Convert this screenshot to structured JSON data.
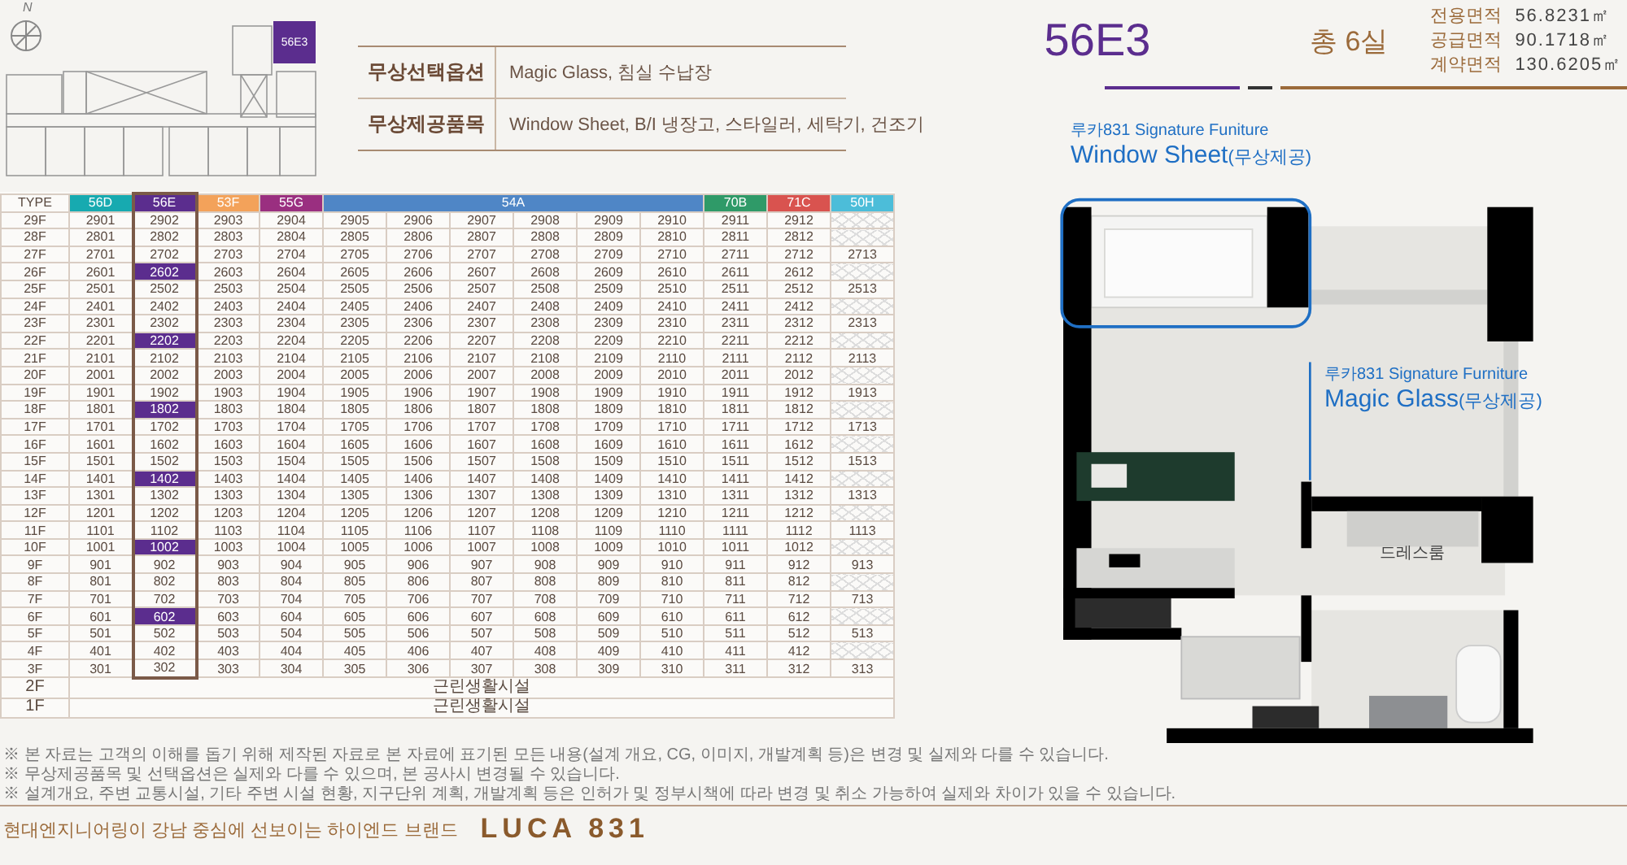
{
  "site_plan": {
    "compass_label": "N",
    "unit_label": "56E3"
  },
  "options": [
    {
      "label": "무상선택옵션",
      "value": "Magic Glass, 침실 수납장"
    },
    {
      "label": "무상제공품목",
      "value": "Window Sheet, B/I 냉장고, 스타일러, 세탁기, 건조기"
    }
  ],
  "unit_table": {
    "corner": "TYPE",
    "types": [
      {
        "label": "56D",
        "color": "#17aab0",
        "wide": false,
        "selected": false
      },
      {
        "label": "56E",
        "color": "#5b2d8e",
        "wide": false,
        "selected": true
      },
      {
        "label": "53F",
        "color": "#f3a25a",
        "wide": false,
        "selected": false
      },
      {
        "label": "55G",
        "color": "#9a2f80",
        "wide": false,
        "selected": false
      },
      {
        "label": "54A",
        "color": "#4f86c6",
        "wide": true,
        "selected": false
      },
      {
        "label": "70B",
        "color": "#2f9a68",
        "wide": false,
        "selected": false
      },
      {
        "label": "71C",
        "color": "#d9534f",
        "wide": false,
        "selected": false
      },
      {
        "label": "50H",
        "color": "#4cbdd9",
        "wide": false,
        "selected": false
      }
    ],
    "rows": [
      {
        "floor": "29F",
        "units": [
          "2901",
          "2902",
          "2903",
          "2904",
          "2905",
          "2906",
          "2907",
          "2908",
          "2909",
          "2910",
          "2911",
          "2912"
        ],
        "highlighted": false
      },
      {
        "floor": "28F",
        "units": [
          "2801",
          "2802",
          "2803",
          "2804",
          "2805",
          "2806",
          "2807",
          "2808",
          "2809",
          "2810",
          "2811",
          "2812"
        ],
        "highlighted": false
      },
      {
        "floor": "27F",
        "units": [
          "2701",
          "2702",
          "2703",
          "2704",
          "2705",
          "2706",
          "2707",
          "2708",
          "2709",
          "2710",
          "2711",
          "2712",
          "2713"
        ],
        "highlighted": false
      },
      {
        "floor": "26F",
        "units": [
          "2601",
          "2602",
          "2603",
          "2604",
          "2605",
          "2606",
          "2607",
          "2608",
          "2609",
          "2610",
          "2611",
          "2612"
        ],
        "highlighted": true
      },
      {
        "floor": "25F",
        "units": [
          "2501",
          "2502",
          "2503",
          "2504",
          "2505",
          "2506",
          "2507",
          "2508",
          "2509",
          "2510",
          "2511",
          "2512",
          "2513"
        ],
        "highlighted": false
      },
      {
        "floor": "24F",
        "units": [
          "2401",
          "2402",
          "2403",
          "2404",
          "2405",
          "2406",
          "2407",
          "2408",
          "2409",
          "2410",
          "2411",
          "2412"
        ],
        "highlighted": false
      },
      {
        "floor": "23F",
        "units": [
          "2301",
          "2302",
          "2303",
          "2304",
          "2305",
          "2306",
          "2307",
          "2308",
          "2309",
          "2310",
          "2311",
          "2312",
          "2313"
        ],
        "highlighted": false
      },
      {
        "floor": "22F",
        "units": [
          "2201",
          "2202",
          "2203",
          "2204",
          "2205",
          "2206",
          "2207",
          "2208",
          "2209",
          "2210",
          "2211",
          "2212"
        ],
        "highlighted": true
      },
      {
        "floor": "21F",
        "units": [
          "2101",
          "2102",
          "2103",
          "2104",
          "2105",
          "2106",
          "2107",
          "2108",
          "2109",
          "2110",
          "2111",
          "2112",
          "2113"
        ],
        "highlighted": false
      },
      {
        "floor": "20F",
        "units": [
          "2001",
          "2002",
          "2003",
          "2004",
          "2005",
          "2006",
          "2007",
          "2008",
          "2009",
          "2010",
          "2011",
          "2012"
        ],
        "highlighted": false
      },
      {
        "floor": "19F",
        "units": [
          "1901",
          "1902",
          "1903",
          "1904",
          "1905",
          "1906",
          "1907",
          "1908",
          "1909",
          "1910",
          "1911",
          "1912",
          "1913"
        ],
        "highlighted": false
      },
      {
        "floor": "18F",
        "units": [
          "1801",
          "1802",
          "1803",
          "1804",
          "1805",
          "1806",
          "1807",
          "1808",
          "1809",
          "1810",
          "1811",
          "1812"
        ],
        "highlighted": true
      },
      {
        "floor": "17F",
        "units": [
          "1701",
          "1702",
          "1703",
          "1704",
          "1705",
          "1706",
          "1707",
          "1708",
          "1709",
          "1710",
          "1711",
          "1712",
          "1713"
        ],
        "highlighted": false
      },
      {
        "floor": "16F",
        "units": [
          "1601",
          "1602",
          "1603",
          "1604",
          "1605",
          "1606",
          "1607",
          "1608",
          "1609",
          "1610",
          "1611",
          "1612"
        ],
        "highlighted": false
      },
      {
        "floor": "15F",
        "units": [
          "1501",
          "1502",
          "1503",
          "1504",
          "1505",
          "1506",
          "1507",
          "1508",
          "1509",
          "1510",
          "1511",
          "1512",
          "1513"
        ],
        "highlighted": false
      },
      {
        "floor": "14F",
        "units": [
          "1401",
          "1402",
          "1403",
          "1404",
          "1405",
          "1406",
          "1407",
          "1408",
          "1409",
          "1410",
          "1411",
          "1412"
        ],
        "highlighted": true
      },
      {
        "floor": "13F",
        "units": [
          "1301",
          "1302",
          "1303",
          "1304",
          "1305",
          "1306",
          "1307",
          "1308",
          "1309",
          "1310",
          "1311",
          "1312",
          "1313"
        ],
        "highlighted": false
      },
      {
        "floor": "12F",
        "units": [
          "1201",
          "1202",
          "1203",
          "1204",
          "1205",
          "1206",
          "1207",
          "1208",
          "1209",
          "1210",
          "1211",
          "1212"
        ],
        "highlighted": false
      },
      {
        "floor": "11F",
        "units": [
          "1101",
          "1102",
          "1103",
          "1104",
          "1105",
          "1106",
          "1107",
          "1108",
          "1109",
          "1110",
          "1111",
          "1112",
          "1113"
        ],
        "highlighted": false
      },
      {
        "floor": "10F",
        "units": [
          "1001",
          "1002",
          "1003",
          "1004",
          "1005",
          "1006",
          "1007",
          "1008",
          "1009",
          "1010",
          "1011",
          "1012"
        ],
        "highlighted": true
      },
      {
        "floor": "9F",
        "units": [
          "901",
          "902",
          "903",
          "904",
          "905",
          "906",
          "907",
          "908",
          "909",
          "910",
          "911",
          "912",
          "913"
        ],
        "highlighted": false
      },
      {
        "floor": "8F",
        "units": [
          "801",
          "802",
          "803",
          "804",
          "805",
          "806",
          "807",
          "808",
          "809",
          "810",
          "811",
          "812"
        ],
        "highlighted": false
      },
      {
        "floor": "7F",
        "units": [
          "701",
          "702",
          "703",
          "704",
          "705",
          "706",
          "707",
          "708",
          "709",
          "710",
          "711",
          "712",
          "713"
        ],
        "highlighted": false
      },
      {
        "floor": "6F",
        "units": [
          "601",
          "602",
          "603",
          "604",
          "605",
          "606",
          "607",
          "608",
          "609",
          "610",
          "611",
          "612"
        ],
        "highlighted": true
      },
      {
        "floor": "5F",
        "units": [
          "501",
          "502",
          "503",
          "504",
          "505",
          "506",
          "507",
          "508",
          "509",
          "510",
          "511",
          "512",
          "513"
        ],
        "highlighted": false
      },
      {
        "floor": "4F",
        "units": [
          "401",
          "402",
          "403",
          "404",
          "405",
          "406",
          "407",
          "408",
          "409",
          "410",
          "411",
          "412"
        ],
        "highlighted": false
      },
      {
        "floor": "3F",
        "units": [
          "301",
          "302",
          "303",
          "304",
          "305",
          "306",
          "307",
          "308",
          "309",
          "310",
          "311",
          "312",
          "313"
        ],
        "highlighted": false
      },
      {
        "floor": "2F",
        "facility": "근린생활시설"
      },
      {
        "floor": "1F",
        "facility": "근린생활시설"
      }
    ]
  },
  "notes": [
    "※ 본 자료는 고객의 이해를 돕기 위해 제작된 자료로 본 자료에 표기된 모든 내용(설계 개요, CG, 이미지, 개발계획 등)은 변경 및 실제와 다를 수 있습니다.",
    "※ 무상제공품목 및 선택옵션은 실제와 다를 수 있으며, 본 공사시 변경될 수 있습니다.",
    "※ 설계개요, 주변 교통시설, 기타 주변 시설 현황, 지구단위 계획, 개발계획 등은 인허가 및 정부시책에 따라 변경 및 취소 가능하여 실제와 차이가 있을 수 있습니다."
  ],
  "brand": {
    "tagline": "현대엔지니어링이 강남 중심에 선보이는 하이엔드 브랜드",
    "logo": "LUCA 831"
  },
  "unit": {
    "type": "56E3",
    "count": "총 6실",
    "areas": [
      {
        "label": "전용면적",
        "value": "56.8231㎡"
      },
      {
        "label": "공급면적",
        "value": "90.1718㎡"
      },
      {
        "label": "계약면적",
        "value": "130.6205㎡"
      }
    ]
  },
  "plan_labels": [
    {
      "kind": "window",
      "subtitle": "루카831 Signature Funiture",
      "title": "Window Sheet",
      "note": "(무상제공)"
    },
    {
      "kind": "glass",
      "subtitle": "루카831 Signature Furniture",
      "title": "Magic Glass",
      "note": "(무상제공)"
    },
    {
      "kind": "room",
      "title": "드레스룸"
    }
  ]
}
